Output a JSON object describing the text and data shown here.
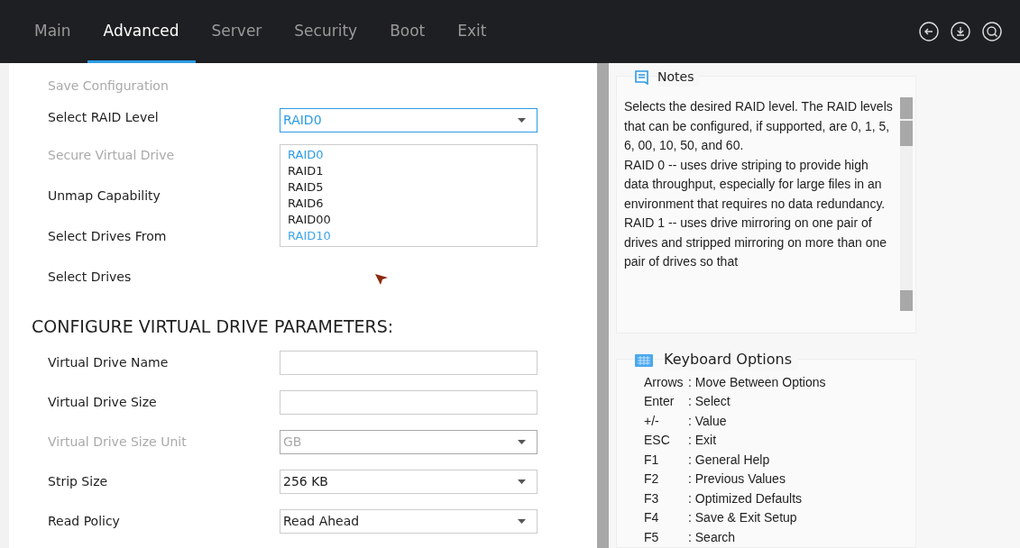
{
  "tabs": [
    {
      "label": "Main",
      "selected": false
    },
    {
      "label": "Advanced",
      "selected": true
    },
    {
      "label": "Server",
      "selected": false
    },
    {
      "label": "Security",
      "selected": false
    },
    {
      "label": "Boot",
      "selected": false
    },
    {
      "label": "Exit",
      "selected": false
    }
  ],
  "settings": [
    {
      "label": "Save Configuration",
      "kind": "label",
      "disabled": true
    },
    {
      "label": "Select RAID Level",
      "kind": "select",
      "disabled": false,
      "focused": true,
      "value": "RAID0",
      "options": [
        {
          "label": "RAID0",
          "selected": true,
          "highlighted": false
        },
        {
          "label": "RAID1",
          "selected": false,
          "highlighted": false
        },
        {
          "label": "RAID5",
          "selected": false,
          "highlighted": false
        },
        {
          "label": "RAID6",
          "selected": false,
          "highlighted": false
        },
        {
          "label": "RAID00",
          "selected": false,
          "highlighted": false
        },
        {
          "label": "RAID10",
          "selected": false,
          "highlighted": true
        }
      ]
    },
    {
      "label": "Secure Virtual Drive",
      "kind": "label",
      "disabled": true
    },
    {
      "label": "Unmap Capability",
      "kind": "label",
      "disabled": false
    },
    {
      "label": "Select Drives From",
      "kind": "label",
      "disabled": false
    },
    {
      "label": "Select Drives",
      "kind": "label",
      "disabled": false
    }
  ],
  "parameters": {
    "heading": "CONFIGURE VIRTUAL DRIVE PARAMETERS:",
    "rows": [
      {
        "label": "Virtual Drive Name",
        "kind": "text",
        "disabled": false,
        "value": ""
      },
      {
        "label": "Virtual Drive Size",
        "kind": "text",
        "disabled": false,
        "value": ""
      },
      {
        "label": "Virtual Drive Size Unit",
        "kind": "select",
        "disabled": true,
        "value": "GB"
      },
      {
        "label": "Strip Size",
        "kind": "select",
        "disabled": false,
        "value": "256 KB"
      },
      {
        "label": "Read Policy",
        "kind": "select",
        "disabled": false,
        "value": "Read Ahead"
      }
    ]
  },
  "notes": {
    "title": "Notes",
    "paragraphs": [
      "Selects the desired RAID level. The RAID levels that can be configured, if supported, are 0, 1, 5, 6, 00, 10, 50, and 60.",
      "RAID 0 -- uses drive striping to provide high data throughput, especially for large files in an environment that requires no data redundancy.",
      "RAID 1 -- uses drive mirroring on one pair of drives and stripped mirroring on more than one pair of drives so that"
    ]
  },
  "keyboard_options": {
    "title": "Keyboard Options",
    "items": [
      {
        "key": "Arrows",
        "action": ": Move Between Options"
      },
      {
        "key": "Enter",
        "action": ": Select"
      },
      {
        "key": "+/-",
        "action": ": Value"
      },
      {
        "key": "ESC",
        "action": ": Exit"
      },
      {
        "key": "F1",
        "action": ": General Help"
      },
      {
        "key": "F2",
        "action": ": Previous Values"
      },
      {
        "key": "F3",
        "action": ": Optimized Defaults"
      },
      {
        "key": "F4",
        "action": ": Save & Exit Setup"
      },
      {
        "key": "F5",
        "action": ": Search"
      }
    ]
  }
}
